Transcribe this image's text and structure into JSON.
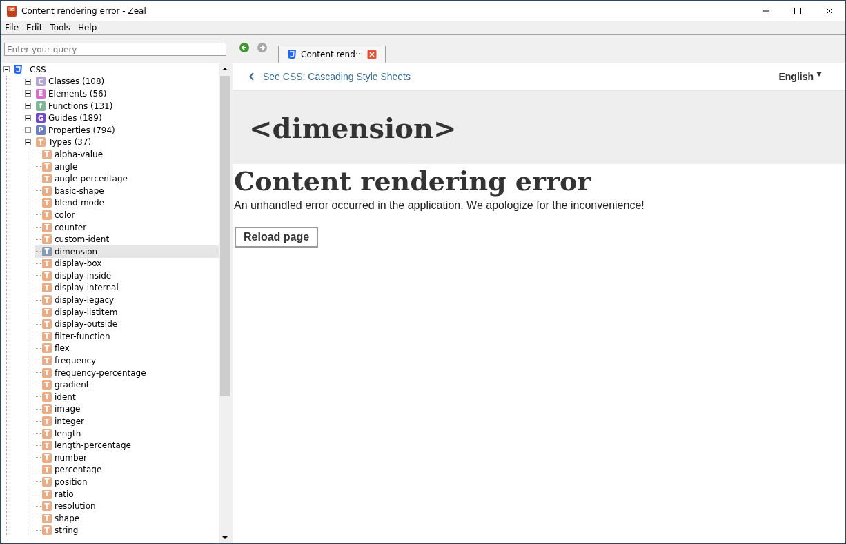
{
  "window": {
    "title": "Content rendering error - Zeal"
  },
  "menu": [
    "File",
    "Edit",
    "Tools",
    "Help"
  ],
  "search": {
    "placeholder": "Enter your query"
  },
  "tabs": [
    {
      "label": "Content rend···",
      "selected": true
    }
  ],
  "tree": [
    {
      "label": "CSS",
      "kind": "docset",
      "expanded": true,
      "children": [
        {
          "label": "Classes (108)",
          "kind": "group",
          "letter": "C",
          "color": "#b3a3cf",
          "expanded": false
        },
        {
          "label": "Elements (56)",
          "kind": "group",
          "letter": "E",
          "color": "#d46fcf",
          "expanded": false
        },
        {
          "label": "Functions (131)",
          "kind": "group",
          "letter": "f",
          "color": "#7fb796",
          "expanded": false
        },
        {
          "label": "Guides (189)",
          "kind": "group",
          "letter": "G",
          "color": "#7547c9",
          "expanded": false
        },
        {
          "label": "Properties (794)",
          "kind": "group",
          "letter": "P",
          "color": "#6b7fc2",
          "expanded": false
        },
        {
          "label": "Types (37)",
          "kind": "group",
          "letter": "T",
          "color": "#e6ad88",
          "expanded": true,
          "children": [
            {
              "label": "alpha-value",
              "letter": "T",
              "selected": false
            },
            {
              "label": "angle",
              "letter": "T",
              "selected": false
            },
            {
              "label": "angle-percentage",
              "letter": "T",
              "selected": false
            },
            {
              "label": "basic-shape",
              "letter": "T",
              "selected": false
            },
            {
              "label": "blend-mode",
              "letter": "T",
              "selected": false
            },
            {
              "label": "color",
              "letter": "T",
              "selected": false
            },
            {
              "label": "counter",
              "letter": "T",
              "selected": false
            },
            {
              "label": "custom-ident",
              "letter": "T",
              "selected": false
            },
            {
              "label": "dimension",
              "letter": "T",
              "selected": true
            },
            {
              "label": "display-box",
              "letter": "T",
              "selected": false
            },
            {
              "label": "display-inside",
              "letter": "T",
              "selected": false
            },
            {
              "label": "display-internal",
              "letter": "T",
              "selected": false
            },
            {
              "label": "display-legacy",
              "letter": "T",
              "selected": false
            },
            {
              "label": "display-listitem",
              "letter": "T",
              "selected": false
            },
            {
              "label": "display-outside",
              "letter": "T",
              "selected": false
            },
            {
              "label": "filter-function",
              "letter": "T",
              "selected": false
            },
            {
              "label": "flex",
              "letter": "T",
              "selected": false
            },
            {
              "label": "frequency",
              "letter": "T",
              "selected": false
            },
            {
              "label": "frequency-percentage",
              "letter": "T",
              "selected": false
            },
            {
              "label": "gradient",
              "letter": "T",
              "selected": false
            },
            {
              "label": "ident",
              "letter": "T",
              "selected": false
            },
            {
              "label": "image",
              "letter": "T",
              "selected": false
            },
            {
              "label": "integer",
              "letter": "T",
              "selected": false
            },
            {
              "label": "length",
              "letter": "T",
              "selected": false
            },
            {
              "label": "length-percentage",
              "letter": "T",
              "selected": false
            },
            {
              "label": "number",
              "letter": "T",
              "selected": false
            },
            {
              "label": "percentage",
              "letter": "T",
              "selected": false
            },
            {
              "label": "position",
              "letter": "T",
              "selected": false
            },
            {
              "label": "ratio",
              "letter": "T",
              "selected": false
            },
            {
              "label": "resolution",
              "letter": "T",
              "selected": false
            },
            {
              "label": "shape",
              "letter": "T",
              "selected": false
            },
            {
              "label": "string",
              "letter": "T",
              "selected": false
            }
          ]
        }
      ]
    }
  ],
  "page": {
    "back_link": "See CSS: Cascading Style Sheets",
    "language": "English",
    "heading": "<dimension>",
    "error_title": "Content rendering error",
    "message": "An unhandled error occurred in the application. We apologize for the inconvenience!",
    "button": "Reload page"
  }
}
